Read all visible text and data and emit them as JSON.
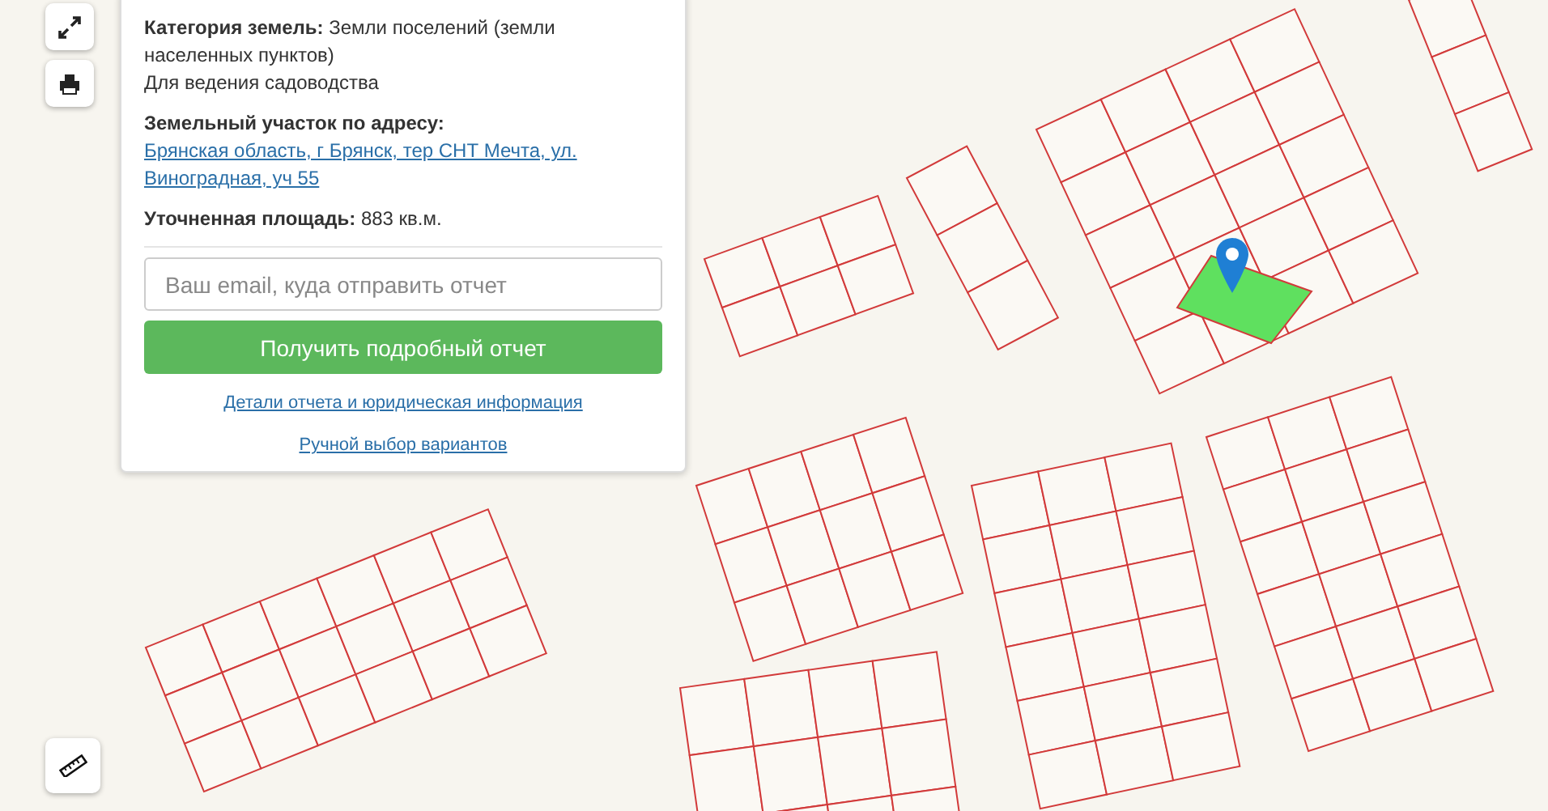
{
  "map_controls": [
    {
      "kind": "fullscreen"
    },
    {
      "kind": "print"
    }
  ],
  "info_panel": {
    "category": {
      "label": "Категория земель:",
      "value": "Земли поселений (земли населенных пунктов)"
    },
    "purpose": "Для ведения садоводства",
    "address": {
      "label": "Земельный участок по адресу:",
      "link": "Брянская область, г Брянск, тер СНТ Мечта, ул. Виноградная, уч 55"
    },
    "area": {
      "label": "Уточненная площадь:",
      "value": "883 кв.м."
    },
    "email": {
      "placeholder": "Ваш email, куда отправить отчет"
    },
    "submit": "Получить подробный отчет",
    "links": [
      "Детали отчета и юридическая информация",
      "Ручной выбор вариантов"
    ]
  },
  "ruler_control": {
    "kind": "ruler"
  }
}
